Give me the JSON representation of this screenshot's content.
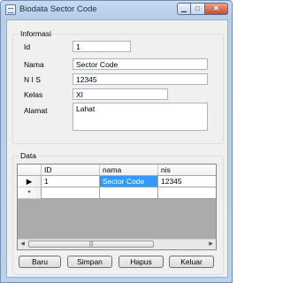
{
  "window": {
    "title": "Biodata Sector Code",
    "min_glyph": "▁",
    "max_glyph": "□",
    "close_glyph": "✕"
  },
  "info_group": {
    "legend": "Informasi",
    "fields": {
      "id": {
        "label": "Id",
        "value": "1"
      },
      "nama": {
        "label": "Nama",
        "value": "Sector Code"
      },
      "nis": {
        "label": "N I S",
        "value": "12345"
      },
      "kelas": {
        "label": "Kelas",
        "value": "XI"
      },
      "alamat": {
        "label": "Alamat",
        "value": "Lahat"
      }
    }
  },
  "data_group": {
    "legend": "Data",
    "columns": [
      "ID",
      "nama",
      "nis"
    ],
    "rows": [
      [
        "1",
        "Sector Code",
        "12345"
      ]
    ],
    "current_row_glyph": "▶",
    "new_row_glyph": "*",
    "scroll_left": "◀",
    "scroll_right": "▶",
    "scroll_grip": "|||"
  },
  "buttons": {
    "baru": "Baru",
    "simpan": "Simpan",
    "hapus": "Hapus",
    "keluar": "Keluar"
  }
}
